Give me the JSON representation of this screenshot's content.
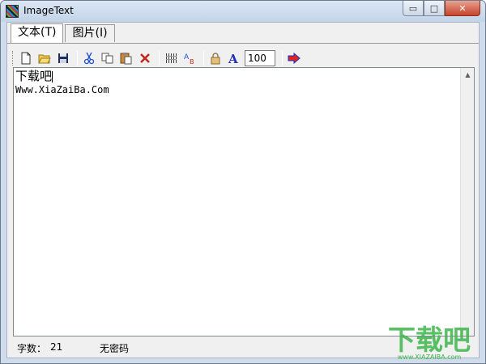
{
  "window": {
    "title": "ImageText",
    "min_glyph": "▭",
    "max_glyph": "□",
    "close_glyph": "✕"
  },
  "tabs": [
    {
      "label": "文本(T)",
      "active": true
    },
    {
      "label": "图片(I)",
      "active": false
    }
  ],
  "toolbar": {
    "icons": [
      "new-file-icon",
      "open-folder-icon",
      "save-icon",
      "cut-icon",
      "copy-icon",
      "paste-icon",
      "delete-icon",
      "grid-icon",
      "text-style-icon",
      "lock-icon",
      "font-icon",
      "next-arrow-icon"
    ],
    "zoom_value": "100"
  },
  "editor": {
    "line1": "下载吧",
    "line2": "Www.XiaZaiBa.Com"
  },
  "status": {
    "char_label": "字数：",
    "char_count": "21",
    "password_status": "无密码"
  },
  "watermark": {
    "text": "下载吧",
    "url": "www.XIAZAIBA.com",
    "color": "#3cb54a"
  }
}
